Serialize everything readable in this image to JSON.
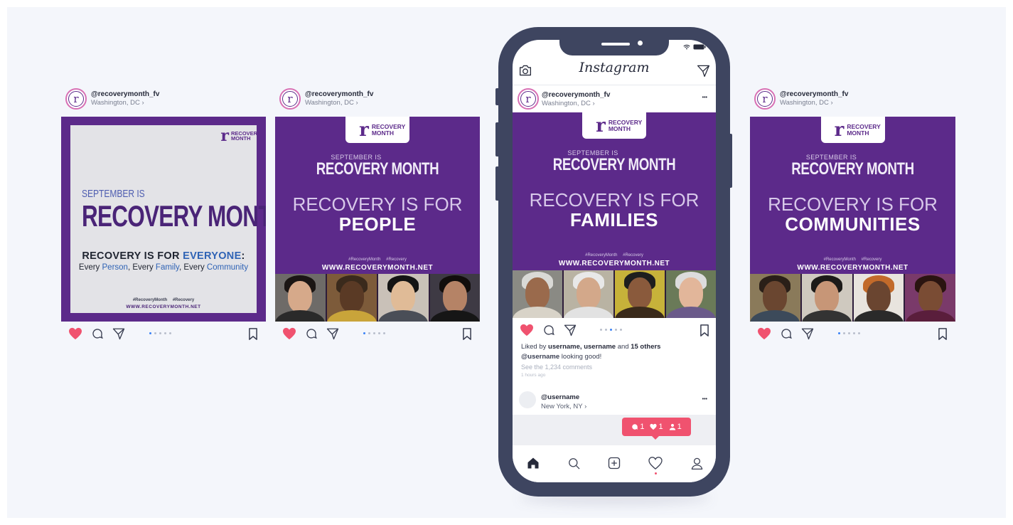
{
  "colors": {
    "background": "#f4f6fb",
    "brand_purple": "#5c2a8a",
    "phone_frame": "#3e4560",
    "like_red": "#f0526f",
    "accent_blue": "#2f63b5",
    "dot_active": "#3b82f6"
  },
  "app": {
    "name": "Instagram"
  },
  "account": {
    "handle": "@recoverymonth_fv",
    "location": "Washington, DC ›"
  },
  "brand_logo": {
    "letter": "r",
    "text": "RECOVERY MONTH"
  },
  "posts": [
    {
      "kicker": "SEPTEMBER IS",
      "headline": "RECOVERY MONTH",
      "line_prefix": "RECOVERY IS FOR ",
      "line_accent": "EVERYONE",
      "line_suffix": ":",
      "every_1": "Every ",
      "every_person": "Person",
      "every_2": ", Every ",
      "every_family": "Family",
      "every_3": ", Every ",
      "every_community": "Community",
      "hashtags": "#RecoveryMonth #Recovery",
      "website": "WWW.RECOVERYMONTH.NET",
      "active_dot": 1
    },
    {
      "kicker": "SEPTEMBER IS",
      "headline": "RECOVERY MONTH",
      "for_line": "RECOVERY IS FOR",
      "for_word": "PEOPLE",
      "hashtags": "#RecoveryMonth #Recovery",
      "website": "WWW.RECOVERYMONTH.NET",
      "active_dot": 1
    },
    {
      "kicker": "SEPTEMBER IS",
      "headline": "RECOVERY MONTH",
      "for_line": "RECOVERY IS FOR",
      "for_word": "FAMILIES",
      "hashtags": "#RecoveryMonth #Recovery",
      "website": "WWW.RECOVERYMONTH.NET",
      "active_dot": 3
    },
    {
      "kicker": "SEPTEMBER IS",
      "headline": "RECOVERY MONTH",
      "for_line": "RECOVERY IS FOR",
      "for_word": "COMMUNITIES",
      "hashtags": "#RecoveryMonth #Recovery",
      "website": "WWW.RECOVERYMONTH.NET",
      "active_dot": 1
    }
  ],
  "phone_post": {
    "more": "•••",
    "likes_prefix": "Liked by ",
    "likes_users": "username, username",
    "likes_and": " and ",
    "likes_others": "15 others",
    "comment_user": "@username",
    "comment_text": " looking good!",
    "see_comments": "See the 1,234 comments",
    "time_ago": "1 hours ago"
  },
  "next_post": {
    "user": "@username",
    "location": "New York, NY ›",
    "more": "•••"
  },
  "notifications": {
    "comments": "1",
    "likes": "1",
    "follows": "1"
  },
  "icons": {
    "like": "heart-icon",
    "comment": "comment-icon",
    "share": "paper-plane-icon",
    "save": "bookmark-icon",
    "camera": "camera-icon",
    "direct": "direct-message-icon",
    "tabs": [
      "home-icon",
      "search-icon",
      "add-post-icon",
      "activity-heart-icon",
      "profile-icon"
    ]
  }
}
